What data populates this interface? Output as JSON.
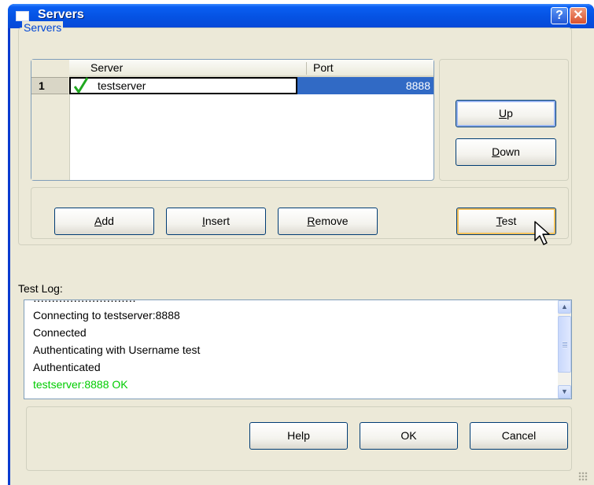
{
  "window": {
    "title": "Servers"
  },
  "servers_group": {
    "legend": "Servers",
    "table": {
      "columns": [
        "Server",
        "Port"
      ],
      "rows": [
        {
          "number": "1",
          "server": "testserver",
          "port": "8888",
          "status_icon": "checkmark-icon"
        }
      ]
    }
  },
  "buttons": {
    "up": {
      "pre": "",
      "key": "U",
      "post": "p"
    },
    "down": {
      "pre": "",
      "key": "D",
      "post": "own"
    },
    "add": {
      "pre": "",
      "key": "A",
      "post": "dd"
    },
    "insert": {
      "pre": "",
      "key": "I",
      "post": "nsert"
    },
    "remove": {
      "pre": "",
      "key": "R",
      "post": "emove"
    },
    "test": {
      "pre": "",
      "key": "T",
      "post": "est"
    },
    "help": "Help",
    "ok": "OK",
    "cancel": "Cancel"
  },
  "test_log": {
    "label": "Test Log:",
    "lines": [
      {
        "text": "Connecting to testserver:8888",
        "color": "#000000"
      },
      {
        "text": "Connected",
        "color": "#000000"
      },
      {
        "text": "Authenticating with Username test",
        "color": "#000000"
      },
      {
        "text": "Authenticated",
        "color": "#000000"
      },
      {
        "text": "testserver:8888 OK",
        "color": "#00cc00"
      }
    ]
  },
  "colors": {
    "title_bar": "#0a5ef2",
    "selection": "#316ac5",
    "legend": "#0046d5",
    "success": "#00cc00"
  }
}
